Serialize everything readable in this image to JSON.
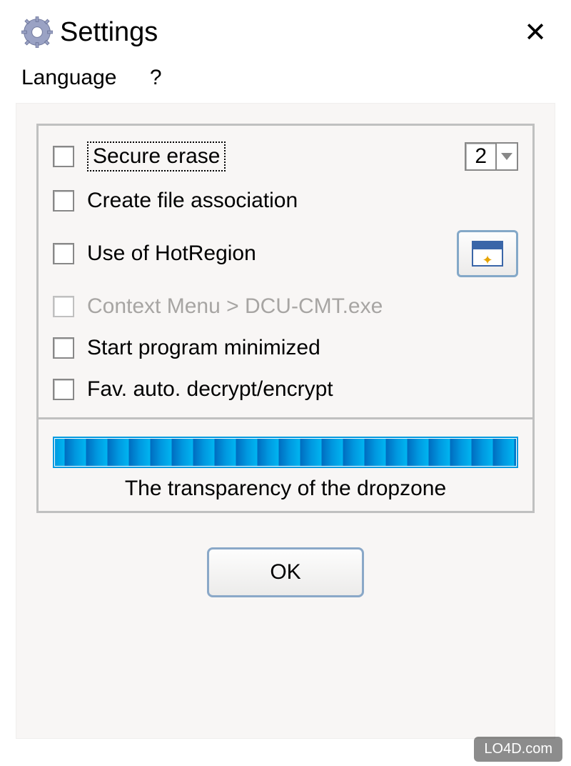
{
  "title": "Settings",
  "menu": {
    "language": "Language",
    "help": "?"
  },
  "options": {
    "secure_erase": {
      "label": "Secure erase",
      "checked": false,
      "value": "2"
    },
    "create_assoc": {
      "label": "Create file association",
      "checked": false
    },
    "hotregion": {
      "label": "Use of HotRegion",
      "checked": false
    },
    "context_menu": {
      "label": "Context Menu > DCU-CMT.exe",
      "checked": false,
      "disabled": true
    },
    "start_min": {
      "label": "Start program minimized",
      "checked": false
    },
    "fav_crypt": {
      "label": "Fav. auto. decrypt/encrypt",
      "checked": false
    }
  },
  "slider": {
    "caption": "The transparency of the dropzone",
    "value": 100
  },
  "ok_label": "OK",
  "watermark": "LO4D.com"
}
